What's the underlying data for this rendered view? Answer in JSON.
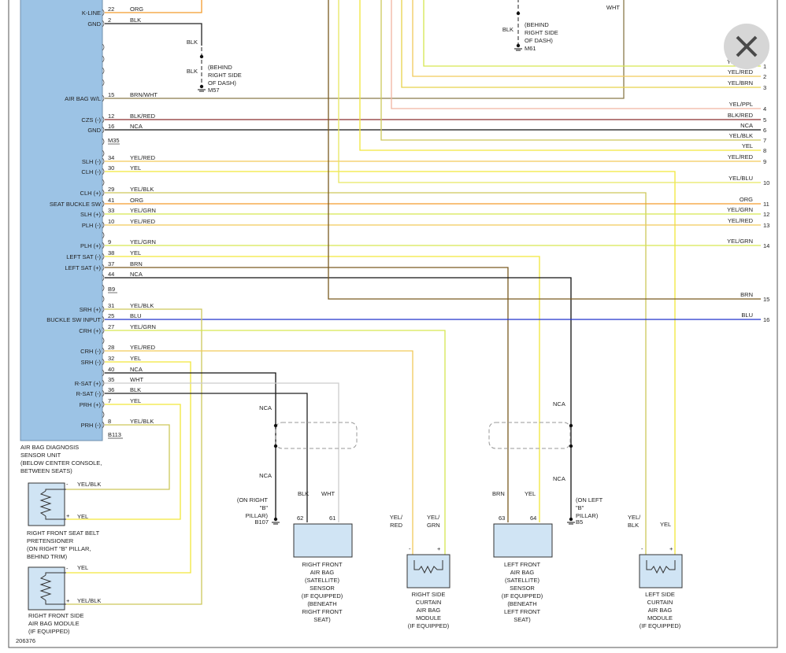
{
  "figure_id": "206376",
  "close_icon": "close-icon",
  "left_pins": [
    {
      "name": "K-LINE",
      "num": "22",
      "color": "ORG"
    },
    {
      "name": "GND",
      "num": "2",
      "color": "BLK"
    },
    {
      "name": "AIR BAG W/L",
      "num": "15",
      "color": "BRN/WHT"
    },
    {
      "name": "CZS (-)",
      "num": "12",
      "color": "BLK/RED"
    },
    {
      "name": "GND",
      "num": "16",
      "color": "NCA"
    },
    {
      "name": "SLH (-)",
      "num": "34",
      "color": "YEL/RED"
    },
    {
      "name": "CLH (-)",
      "num": "30",
      "color": "YEL"
    },
    {
      "name": "CLH (+)",
      "num": "29",
      "color": "YEL/BLK"
    },
    {
      "name": "SEAT BUCKLE SW",
      "num": "41",
      "color": "ORG"
    },
    {
      "name": "SLH (+)",
      "num": "33",
      "color": "YEL/GRN"
    },
    {
      "name": "PLH (-)",
      "num": "10",
      "color": "YEL/RED"
    },
    {
      "name": "PLH (+)",
      "num": "9",
      "color": "YEL/GRN"
    },
    {
      "name": "LEFT SAT (-)",
      "num": "38",
      "color": "YEL"
    },
    {
      "name": "LEFT SAT (+)",
      "num": "37",
      "color": "BRN"
    },
    {
      "name": "",
      "num": "44",
      "color": "NCA"
    },
    {
      "name": "SRH (+)",
      "num": "31",
      "color": "YEL/BLK"
    },
    {
      "name": "BUCKLE SW INPUT",
      "num": "25",
      "color": "BLU"
    },
    {
      "name": "CRH (+)",
      "num": "27",
      "color": "YEL/GRN"
    },
    {
      "name": "CRH (-)",
      "num": "28",
      "color": "YEL/RED"
    },
    {
      "name": "SRH (-)",
      "num": "32",
      "color": "YEL"
    },
    {
      "name": "",
      "num": "40",
      "color": "NCA"
    },
    {
      "name": "R-SAT (+)",
      "num": "35",
      "color": "WHT"
    },
    {
      "name": "R-SAT (-)",
      "num": "36",
      "color": "BLK"
    },
    {
      "name": "PRH (+)",
      "num": "7",
      "color": "YEL"
    },
    {
      "name": "PRH (-)",
      "num": "8",
      "color": "YEL/BLK"
    }
  ],
  "connectors": {
    "m35": "M35",
    "b9": "B9",
    "b113": "B113"
  },
  "right_pins": [
    {
      "num": "1",
      "color": "YEL/GRN"
    },
    {
      "num": "2",
      "color": "YEL/RED"
    },
    {
      "num": "3",
      "color": "YEL/BRN"
    },
    {
      "num": "4",
      "color": "YEL/PPL"
    },
    {
      "num": "5",
      "color": "BLK/RED"
    },
    {
      "num": "6",
      "color": "NCA"
    },
    {
      "num": "7",
      "color": "YEL/BLK"
    },
    {
      "num": "8",
      "color": "YEL"
    },
    {
      "num": "9",
      "color": "YEL/RED"
    },
    {
      "num": "10",
      "color": "YEL/BLU"
    },
    {
      "num": "11",
      "color": "ORG"
    },
    {
      "num": "12",
      "color": "YEL/GRN"
    },
    {
      "num": "13",
      "color": "YEL/RED"
    },
    {
      "num": "14",
      "color": "YEL/GRN"
    },
    {
      "num": "15",
      "color": "BRN"
    },
    {
      "num": "16",
      "color": "BLU"
    }
  ],
  "top_wht": "WHT",
  "ground_m57": {
    "wire_top": "BLK",
    "wire_bottom": "BLK",
    "note": [
      "(BEHIND",
      "RIGHT SIDE",
      "OF DASH)"
    ],
    "id": "M57"
  },
  "ground_m61": {
    "wire": "BLK",
    "note": [
      "(BEHIND",
      "RIGHT SIDE",
      "OF DASH)"
    ],
    "id": "M61"
  },
  "ground_b107": {
    "note": [
      "(ON RIGHT",
      "\"B\"",
      "PILLAR)"
    ],
    "id": "B107"
  },
  "ground_b5": {
    "note": [
      "(ON LEFT",
      "\"B\"",
      "PILLAR)"
    ],
    "id": "B5"
  },
  "ncas": [
    "NCA",
    "NCA",
    "NCA",
    "NCA"
  ],
  "module_caption": [
    "AIR BAG DIAGNOSIS",
    "SENSOR UNIT",
    "(BELOW CENTER CONSOLE,",
    "BETWEEN SEATS)"
  ],
  "pretensioner": {
    "wire_minus": "YEL/BLK",
    "wire_plus": "YEL",
    "caption": [
      "RIGHT FRONT SEAT BELT",
      "PRETENSIONER",
      "(ON RIGHT \"B\" PILLAR,",
      "BEHIND TRIM)"
    ]
  },
  "side_airbag": {
    "wire_minus": "YEL",
    "wire_plus": "YEL/BLK",
    "caption": [
      "RIGHT FRONT SIDE",
      "AIR BAG MODULE",
      "(IF EQUIPPED)"
    ]
  },
  "rf_sensor": {
    "wires": [
      "BLK",
      "WHT"
    ],
    "pins": [
      "62",
      "61"
    ],
    "caption": [
      "RIGHT FRONT",
      "AIR BAG",
      "(SATELLITE)",
      "SENSOR",
      "(IF EQUIPPED)",
      "(BENEATH",
      "RIGHT FRONT",
      "SEAT)"
    ]
  },
  "rs_curtain": {
    "wires": [
      [
        "YEL/",
        "RED"
      ],
      [
        "YEL/",
        "GRN"
      ]
    ],
    "caption": [
      "RIGHT SIDE",
      "CURTAIN",
      "AIR BAG",
      "MODULE",
      "(IF EQUIPPED)"
    ]
  },
  "lf_sensor": {
    "wires": [
      "BRN",
      "YEL"
    ],
    "pins": [
      "63",
      "64"
    ],
    "caption": [
      "LEFT FRONT",
      "AIR BAG",
      "(SATELLITE)",
      "SENSOR",
      "(IF EQUIPPED)",
      "(BENEATH",
      "LEFT FRONT",
      "SEAT)"
    ]
  },
  "ls_curtain": {
    "wires": [
      [
        "YEL/",
        "BLK"
      ],
      [
        "YEL"
      ]
    ],
    "caption": [
      "LEFT SIDE",
      "CURTAIN",
      "AIR BAG",
      "MODULE",
      "(IF EQUIPPED)"
    ]
  },
  "minus_sign": "-",
  "plus_sign": "+",
  "wire_hex": {
    "ORG": "#f39c2c",
    "BLK": "#222222",
    "BRN/WHT": "#8a7a4a",
    "BLK/RED": "#8b2f2f",
    "NCA": "#111111",
    "YEL": "#f2e63a",
    "YEL/RED": "#f2c95a",
    "YEL/GRN": "#d6e650",
    "YEL/BLK": "#cdc85a",
    "YEL/BRN": "#e8d24a",
    "YEL/PPL": "#f0b4a0",
    "YEL/BLU": "#e8e660",
    "BRN": "#7a5a20",
    "BLU": "#2233cc",
    "WHT": "#cccccc"
  }
}
